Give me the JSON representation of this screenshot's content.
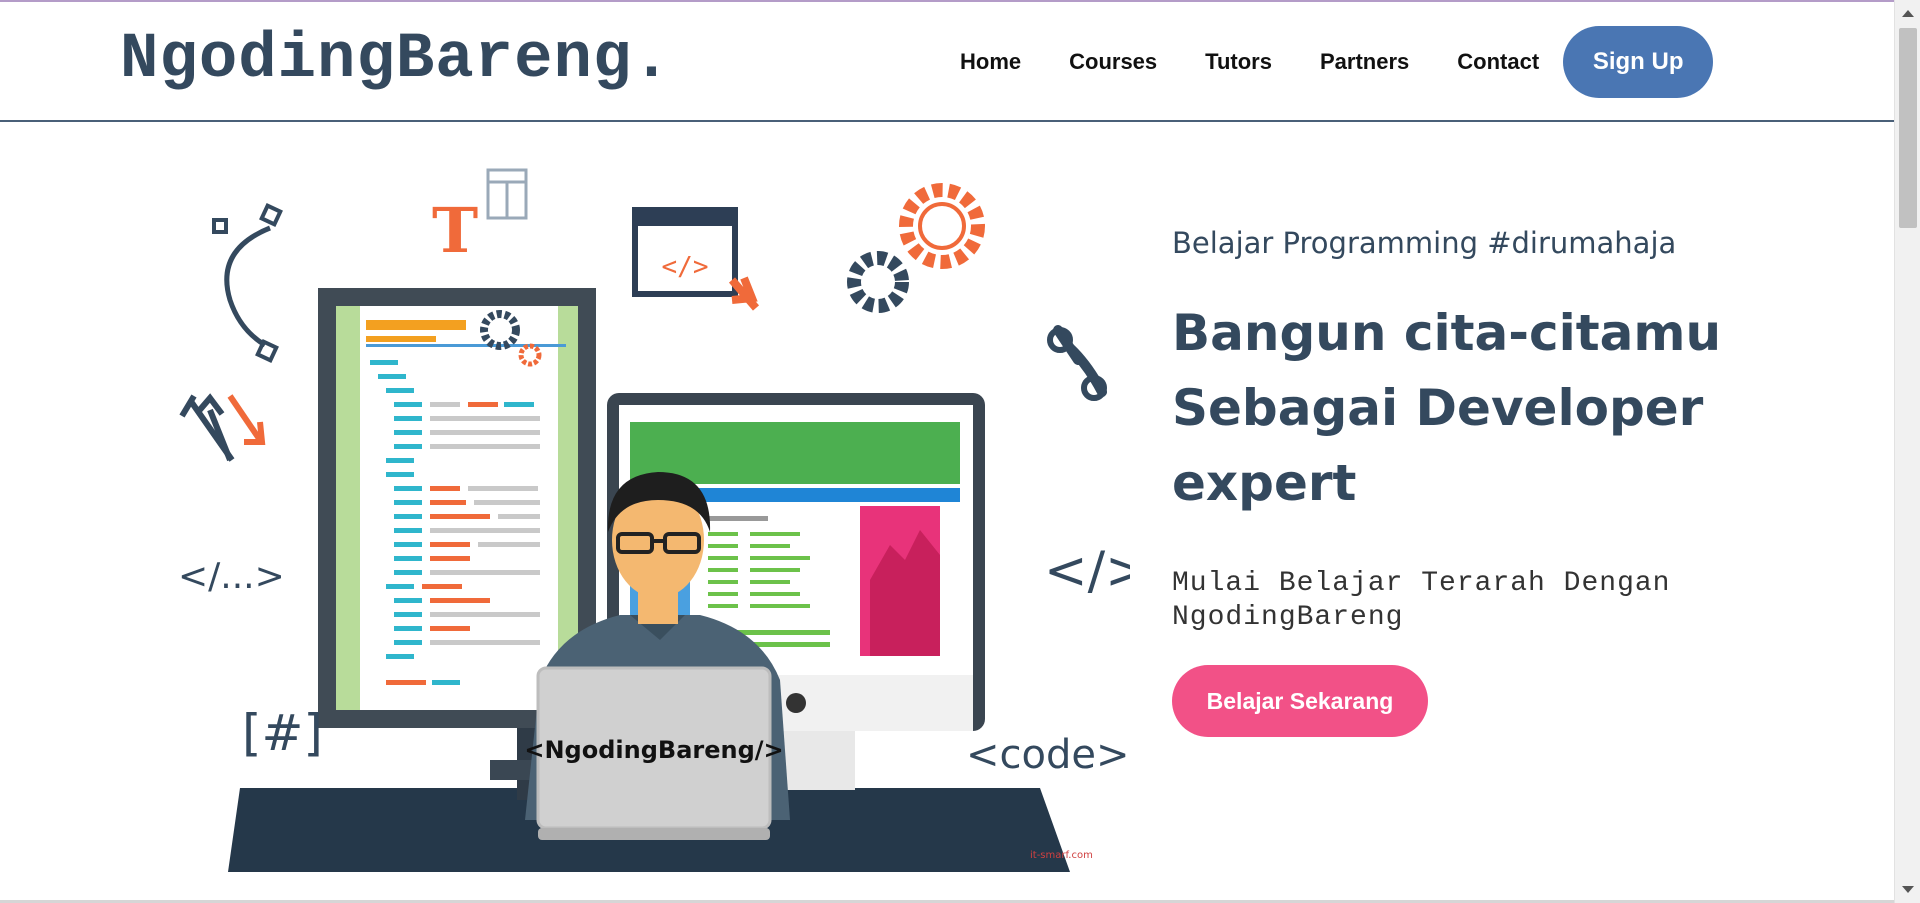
{
  "header": {
    "brand": "NgodingBareng.",
    "nav": [
      "Home",
      "Courses",
      "Tutors",
      "Partners",
      "Contact"
    ],
    "signup_label": "Sign Up"
  },
  "hero": {
    "tagline": "Belajar Programming #dirumahaja",
    "headline_lines": [
      "Bangun cita-citamu",
      "Sebagai Developer",
      "expert"
    ],
    "subline_lines": [
      "Mulai Belajar Terarah Dengan",
      "NgodingBareng"
    ],
    "cta_label": "Belajar Sekarang"
  },
  "illustration": {
    "laptop_label": "<NgodingBareng/>",
    "code_tags": [
      "</...>",
      "</>",
      "[#]",
      "<code>"
    ],
    "watermark": "it-smarf.com",
    "letter": "T",
    "window_tag": "</>"
  },
  "colors": {
    "brand": "#34495e",
    "signup": "#4a76b3",
    "cta": "#f25187",
    "accent_orange": "#f26b3a"
  }
}
